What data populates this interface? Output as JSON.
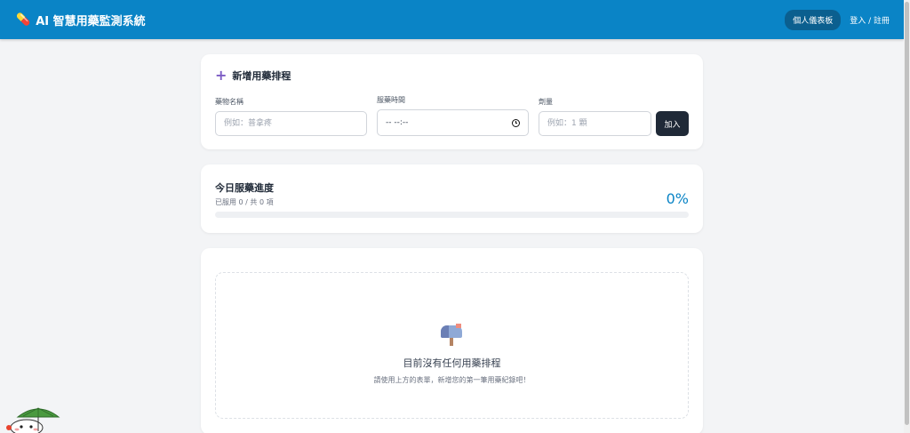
{
  "header": {
    "title": "AI 智慧用藥監測系統",
    "dashboard_label": "個人儀表板",
    "login_label": "登入 / 註冊"
  },
  "add_form": {
    "title": "新增用藥排程",
    "name_label": "藥物名稱",
    "name_placeholder": "例如：普拿疼",
    "time_label": "服藥時間",
    "time_value": "-- --:--",
    "dose_label": "劑量",
    "dose_placeholder": "例如：1 顆",
    "add_label": "加入"
  },
  "progress": {
    "title": "今日服藥進度",
    "subtitle": "已服用 0 / 共 0 項",
    "percent_label": "0%",
    "percent": 0
  },
  "empty_state": {
    "title": "目前沒有任何用藥排程",
    "subtitle": "請使用上方的表單，新增您的第一筆用藥紀錄吧！"
  },
  "colors": {
    "header": "#0a84c6",
    "accent": "#0a84c6",
    "button_dark": "#1f2937"
  }
}
